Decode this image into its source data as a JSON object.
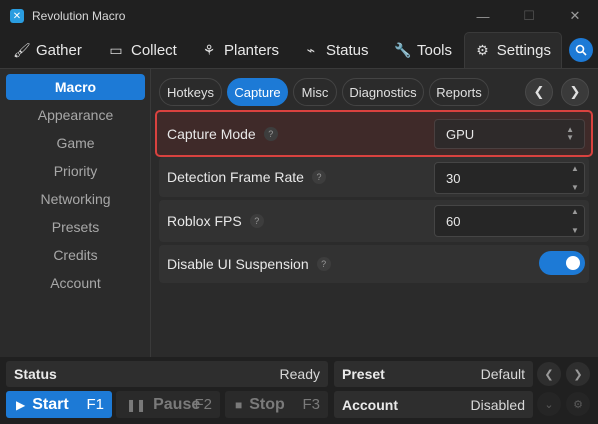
{
  "window": {
    "title": "Revolution Macro",
    "logo_icon": "revolution-logo-icon"
  },
  "nav": {
    "tabs": [
      {
        "label": "Gather",
        "icon": "brush-icon"
      },
      {
        "label": "Collect",
        "icon": "ticket-icon"
      },
      {
        "label": "Planters",
        "icon": "plant-icon"
      },
      {
        "label": "Status",
        "icon": "pulse-icon"
      },
      {
        "label": "Tools",
        "icon": "wrench-icon"
      },
      {
        "label": "Settings",
        "icon": "gear-icon"
      }
    ],
    "active_tab": "Settings"
  },
  "sidebar": {
    "items": [
      {
        "label": "Macro"
      },
      {
        "label": "Appearance"
      },
      {
        "label": "Game"
      },
      {
        "label": "Priority"
      },
      {
        "label": "Networking"
      },
      {
        "label": "Presets"
      },
      {
        "label": "Credits"
      },
      {
        "label": "Account"
      }
    ],
    "active": "Macro"
  },
  "subtabs": {
    "items": [
      {
        "label": "Hotkeys"
      },
      {
        "label": "Capture"
      },
      {
        "label": "Misc"
      },
      {
        "label": "Diagnostics"
      },
      {
        "label": "Reports"
      }
    ],
    "active": "Capture"
  },
  "settings": {
    "capture_mode": {
      "label": "Capture Mode",
      "value": "GPU"
    },
    "detection_frame_rate": {
      "label": "Detection Frame Rate",
      "value": "30"
    },
    "roblox_fps": {
      "label": "Roblox FPS",
      "value": "60"
    },
    "disable_ui_suspension": {
      "label": "Disable UI Suspension",
      "enabled": true
    }
  },
  "help_glyph": "?",
  "status_bar": {
    "status_label": "Status",
    "status_value": "Ready",
    "preset_label": "Preset",
    "preset_value": "Default",
    "account_label": "Account",
    "account_value": "Disabled"
  },
  "controls": {
    "start": {
      "label": "Start",
      "key": "F1"
    },
    "pause": {
      "label": "Pause",
      "key": "F2"
    },
    "stop": {
      "label": "Stop",
      "key": "F3"
    }
  },
  "colors": {
    "accent": "#1d7ad6",
    "highlight_border": "#d9423f",
    "background": "#202020",
    "panel": "#2b2b2b"
  }
}
